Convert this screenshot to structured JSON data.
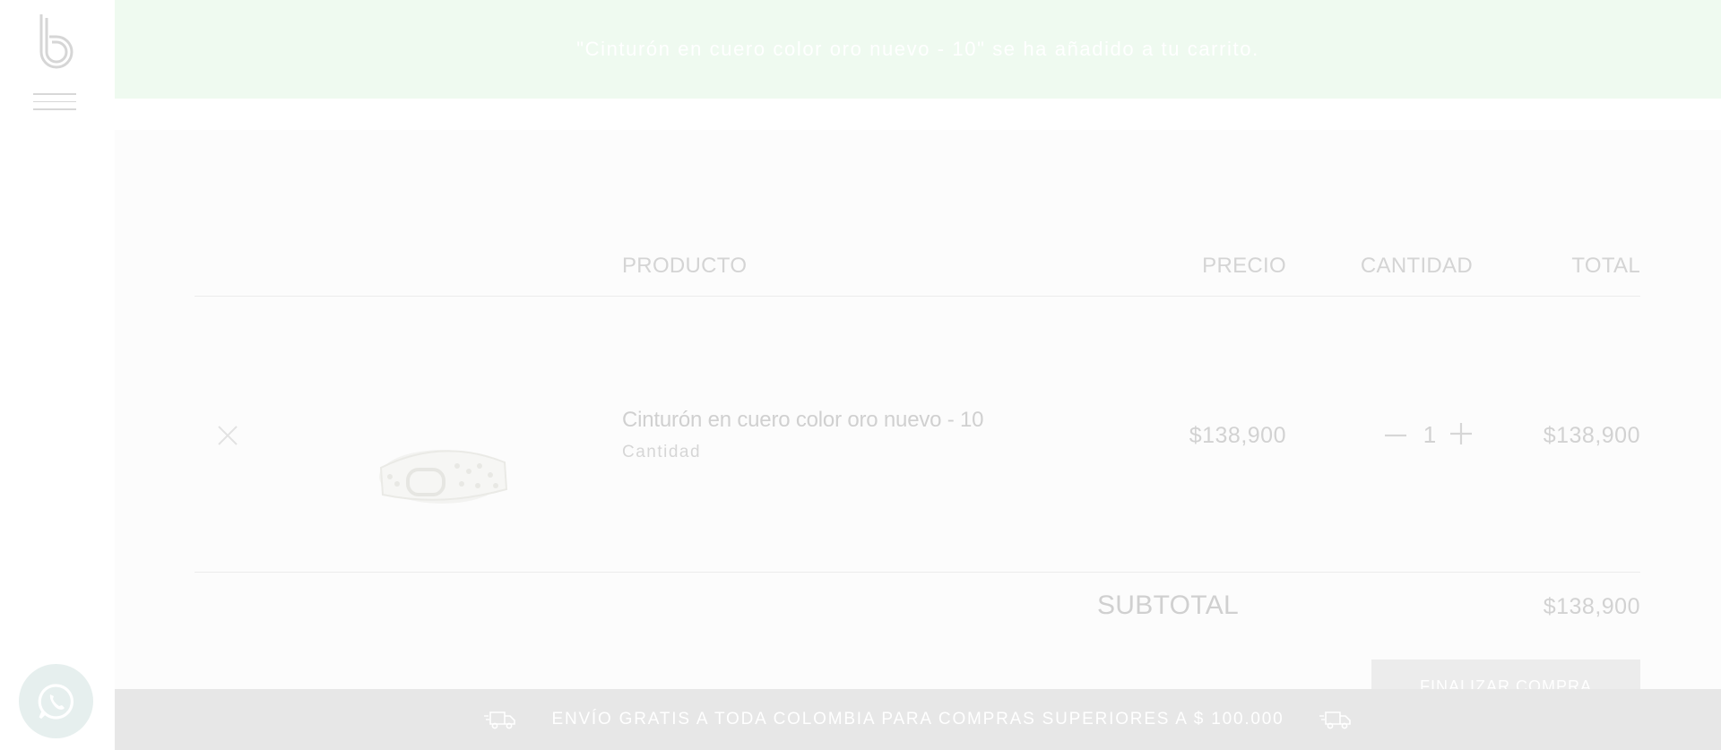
{
  "notice": {
    "text": "\"Cinturón en cuero color oro nuevo - 10\" se ha añadido a tu carrito."
  },
  "sidebar": {
    "logo_icon": "b-logo-icon",
    "menu_icon": "hamburger-icon",
    "whatsapp_icon": "whatsapp-icon"
  },
  "cart": {
    "headers": {
      "product": "PRODUCTO",
      "price": "PRECIO",
      "quantity": "CANTIDAD",
      "total": "TOTAL"
    },
    "items": [
      {
        "name": "Cinturón en cuero color oro nuevo - 10",
        "sub_label": "Cantidad",
        "price": "$138,900",
        "quantity": "1",
        "total": "$138,900",
        "remove_icon": "close-icon",
        "image_icon": "belt-image"
      }
    ],
    "subtotal_label": "SUBTOTAL",
    "subtotal_value": "$138,900",
    "checkout_label": "FINALIZAR COMPRA"
  },
  "shipping_bar": {
    "text": "ENVÍO GRATIS A TODA COLOMBIA PARA COMPRAS SUPERIORES A $ 100.000",
    "icon": "delivery-truck-icon"
  },
  "colors": {
    "notice_bg": "#effaf0",
    "cart_bg": "#fcfcfc",
    "ship_bar_bg": "#e7e7e7",
    "whatsapp_bg": "#e6efee"
  }
}
